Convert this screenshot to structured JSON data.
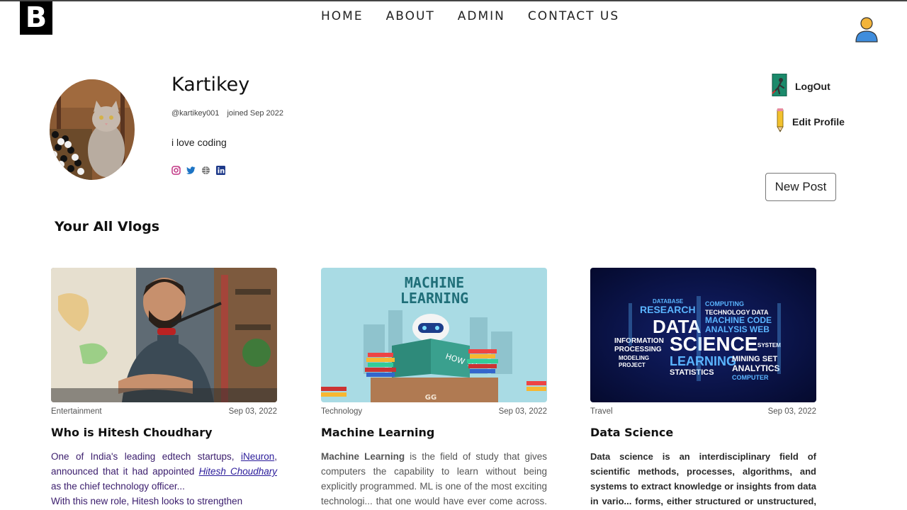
{
  "header": {
    "logo_text": "B",
    "nav": [
      "HOME",
      "ABOUT",
      "ADMIN",
      "CONTACT US"
    ]
  },
  "profile": {
    "name": "Kartikey",
    "handle": "@kartikey001",
    "joined": "joined Sep 2022",
    "bio": "i love coding"
  },
  "actions": {
    "logout": "LogOut",
    "edit_profile": "Edit Profile",
    "new_post": "New Post"
  },
  "section_title": "Your All Vlogs",
  "posts": [
    {
      "category": "Entertainment",
      "date": "Sep 03, 2022",
      "title": "Who is Hitesh Choudhary",
      "excerpt_parts": [
        "One of India's leading edtech startups, ",
        "iNeuron",
        ", announced that it had appointed ",
        "Hitesh Choudhary",
        " as the chief technology officer..."
      ],
      "excerpt_more": "With this new role, Hitesh looks to strengthen"
    },
    {
      "category": "Technology",
      "date": "Sep 03, 2022",
      "title": "Machine Learning",
      "excerpt_lead": "Machine Learning",
      "excerpt": " is the field of study that gives computers the capability to learn without being explicitly programmed. ML is one of the most exciting technologi... that one would have ever come across. As it is evident from"
    },
    {
      "category": "Travel",
      "date": "Sep 03, 2022",
      "title": "Data Science",
      "excerpt": "Data science is an interdisciplinary field of scientific methods, processes, algorithms, and systems to extract knowledge or insights from data in vario... forms, either structured or unstructured, similar to"
    }
  ],
  "thumbnails": {
    "ml_line1": "MACHINE",
    "ml_line2": "LEARNING",
    "ml_book": "HOW TO",
    "ml_logo": "GG",
    "ds_words_big": [
      "DATA",
      "SCIENCE",
      "LEARNING"
    ],
    "ds_words_small": [
      "RESEARCH",
      "MACHINE CODE",
      "ANALYSIS WEB",
      "INFORMATION",
      "PROCESSING",
      "MINING SET",
      "ANALYTICS",
      "STATISTICS",
      "COMPUTER",
      "DATABASE",
      "COMPUTING",
      "TECHNOLOGY DATA",
      "MODELING",
      "PROJECT",
      "SYSTEM"
    ]
  }
}
